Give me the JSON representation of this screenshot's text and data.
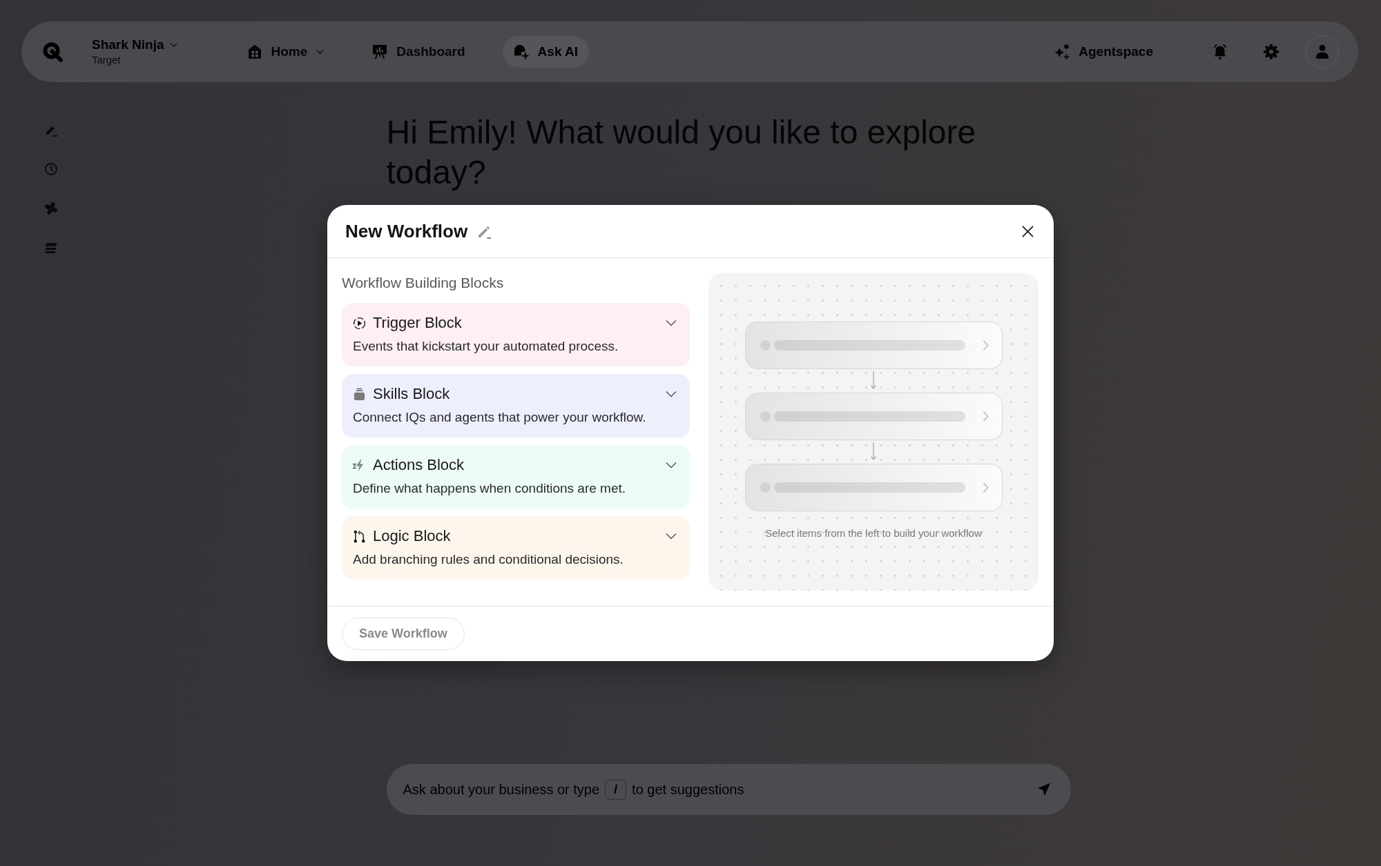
{
  "header": {
    "org": {
      "name": "Shark Ninja",
      "subtitle": "Target"
    },
    "nav": [
      {
        "label": "Home",
        "kind": "home",
        "selected": false,
        "dropdown": true
      },
      {
        "label": "Dashboard",
        "kind": "dashboard",
        "selected": false,
        "dropdown": false
      },
      {
        "label": "Ask AI",
        "kind": "ask_ai",
        "selected": true,
        "dropdown": false
      }
    ],
    "agentspace_button": "Agentspace"
  },
  "greeting": "Hi Emily! What would you like to explore today?",
  "dialog": {
    "title": "New Workflow",
    "section_title": "Workflow Building Blocks",
    "blocks": [
      {
        "kind": "trigger",
        "title": "Trigger Block",
        "description": "Events that kickstart your automated process.",
        "color": "#fdeff3",
        "expanded": false
      },
      {
        "kind": "skills",
        "title": "Skills Block",
        "description": "Connect IQs and agents that power your workflow.",
        "color": "#edeffc",
        "expanded": false
      },
      {
        "kind": "actions",
        "title": "Actions Block",
        "description": "Define what happens when conditions are met.",
        "color": "#ecfbf5",
        "expanded": false
      },
      {
        "kind": "logic",
        "title": "Logic Block",
        "description": "Add branching rules and conditional decisions.",
        "color": "#fdf6ec",
        "expanded": false
      }
    ],
    "preview": {
      "caption": "Select items from the left to build your workflow"
    },
    "save_button": {
      "label": "Save Workflow",
      "disabled": true
    }
  },
  "prompt_bar": {
    "hint_before": "Ask about your business or type",
    "shortcut_key": "/",
    "hint_after": "to get suggestions"
  }
}
